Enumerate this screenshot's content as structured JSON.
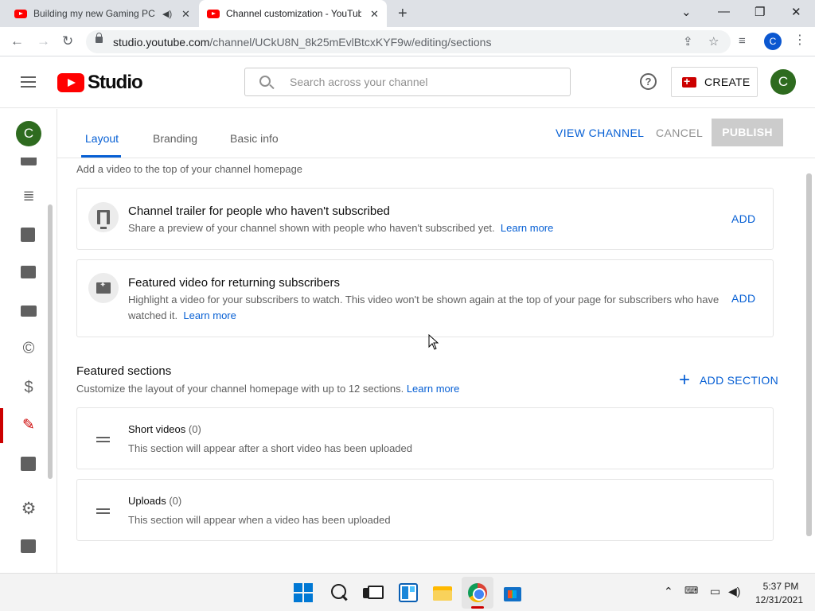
{
  "browser": {
    "tabs": [
      {
        "title": "Building my new Gaming PC",
        "active": false,
        "audio": true
      },
      {
        "title": "Channel customization - YouTube Studio",
        "active": true,
        "audio": false
      }
    ],
    "url_host": "studio.youtube.com",
    "url_path": "/channel/UCkU8N_8k25mEvlBtcxKYF9w/editing/sections",
    "profile_initial": "C"
  },
  "header": {
    "logo_text": "Studio",
    "search_placeholder": "Search across your channel",
    "create_label": "CREATE",
    "avatar_initial": "C"
  },
  "sidebar": {
    "avatar_initial": "C",
    "items": [
      {
        "icon": "content-icon",
        "active": false
      },
      {
        "icon": "playlists-icon",
        "active": false
      },
      {
        "icon": "analytics-icon",
        "active": false
      },
      {
        "icon": "comments-icon",
        "active": false
      },
      {
        "icon": "subtitles-icon",
        "active": false
      },
      {
        "icon": "copyright-icon",
        "active": false
      },
      {
        "icon": "monetization-icon",
        "active": false
      },
      {
        "icon": "customization-icon",
        "active": true
      },
      {
        "icon": "audio-library-icon",
        "active": false
      },
      {
        "icon": "settings-icon",
        "active": false
      },
      {
        "icon": "feedback-icon",
        "active": false
      }
    ]
  },
  "tabs": {
    "layout": "Layout",
    "branding": "Branding",
    "basic_info": "Basic info"
  },
  "actions": {
    "view_channel": "VIEW CHANNEL",
    "cancel": "CANCEL",
    "publish": "PUBLISH"
  },
  "spotlight": {
    "intro": "Add a video to the top of your channel homepage",
    "trailer": {
      "title": "Channel trailer for people who haven't subscribed",
      "desc": "Share a preview of your channel shown with people who haven't subscribed yet.",
      "learn_more": "Learn more",
      "add": "ADD"
    },
    "featured": {
      "title": "Featured video for returning subscribers",
      "desc_line1": "Highlight a video for your subscribers to watch. This video won't be shown again at the top of your page for subscribers who have",
      "desc_line2": "watched it.",
      "learn_more": "Learn more",
      "add": "ADD"
    }
  },
  "featured_sections": {
    "title": "Featured sections",
    "desc": "Customize the layout of your channel homepage with up to 12 sections.",
    "learn_more": "Learn more",
    "add_section": "ADD SECTION",
    "sections": [
      {
        "name": "Short videos",
        "count": "(0)",
        "desc": "This section will appear after a short video has been uploaded"
      },
      {
        "name": "Uploads",
        "count": "(0)",
        "desc": "This section will appear when a video has been uploaded"
      }
    ]
  },
  "taskbar": {
    "time": "5:37 PM",
    "date": "12/31/2021"
  },
  "colors": {
    "accent_blue": "#065fd4",
    "youtube_red": "#ff0000",
    "avatar_green": "#2e6b1f"
  }
}
